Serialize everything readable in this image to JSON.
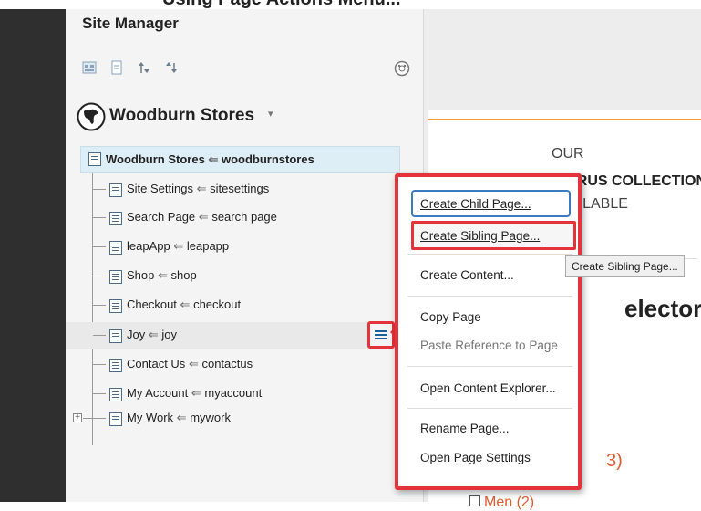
{
  "header": {
    "partial_heading": "Using Page Actions Menu..."
  },
  "panel": {
    "title": "Site Manager",
    "tools": [
      "site-map-icon",
      "page-icon",
      "move-up-icon",
      "move-down-icon"
    ],
    "settings_icon": "globe-settings-icon"
  },
  "site_selector": {
    "name": "Woodburn Stores",
    "caret": "▾"
  },
  "tree": {
    "root": {
      "title": "Woodburn Stores",
      "arrow": "⇐",
      "slug": "woodburnstores"
    },
    "items": [
      {
        "title": "Site Settings",
        "arrow": "⇐",
        "slug": "sitesettings"
      },
      {
        "title": "Search Page",
        "arrow": "⇐",
        "slug": "search page"
      },
      {
        "title": "leapApp",
        "arrow": "⇐",
        "slug": "leapapp"
      },
      {
        "title": "Shop",
        "arrow": "⇐",
        "slug": "shop"
      },
      {
        "title": "Checkout",
        "arrow": "⇐",
        "slug": "checkout"
      },
      {
        "title": "Joy",
        "arrow": "⇐",
        "slug": "joy"
      },
      {
        "title": "Contact Us",
        "arrow": "⇐",
        "slug": "contactus"
      },
      {
        "title": "My Account",
        "arrow": "⇐",
        "slug": "myaccount"
      },
      {
        "title": "My Work",
        "arrow": "⇐",
        "slug": "mywork"
      }
    ],
    "expander_symbol": "+"
  },
  "context_menu": {
    "create_child": "Create Child Page...",
    "create_sibling": "Create Sibling Page...",
    "create_content": "Create Content...",
    "copy_page": "Copy Page",
    "paste_reference": "Paste Reference to Page",
    "open_content_explorer": "Open Content Explorer...",
    "rename_page": "Rename Page...",
    "open_page_settings": "Open Page Settings"
  },
  "tooltip": "Create Sibling Page...",
  "preview": {
    "our": "OUR",
    "collections": "NEW CIRUS COLLECTIONS",
    "available": "AVAILABLE",
    "selector": "elector",
    "count": "3)",
    "men": "Men (2)"
  },
  "colors": {
    "highlight_red": "#e4343b",
    "accent_orange": "#f19a3e",
    "focus_blue": "#3c7bbf"
  }
}
